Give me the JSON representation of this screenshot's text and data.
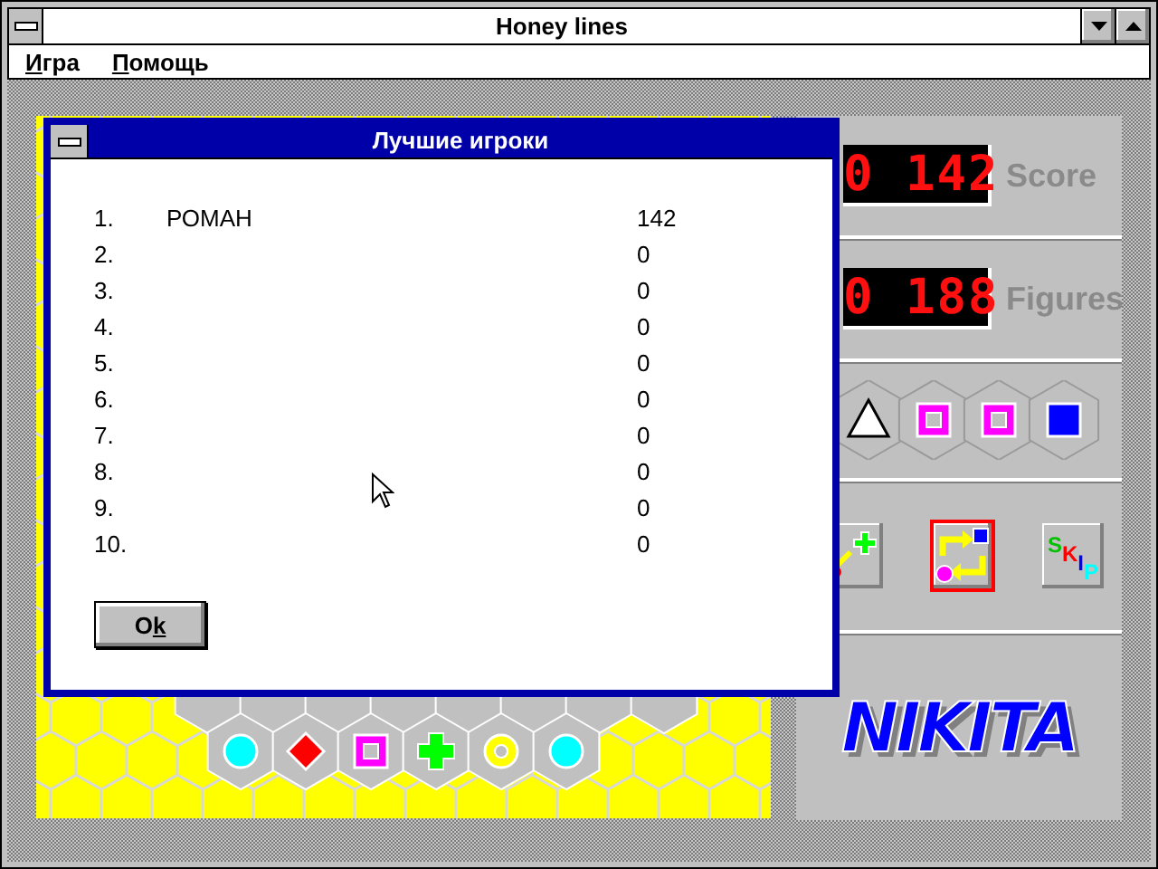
{
  "window": {
    "title": "Honey lines"
  },
  "menu": [
    {
      "label": "Игра"
    },
    {
      "label": "Помощь"
    }
  ],
  "board": {
    "bottom_row": [
      {
        "kind": "circle",
        "color": "#00ffff"
      },
      {
        "kind": "diamond",
        "color": "#ff0000"
      },
      {
        "kind": "square",
        "color": "#ff00ff"
      },
      {
        "kind": "cross",
        "color": "#00ff00"
      },
      {
        "kind": "ring",
        "color": "#ffff00"
      },
      {
        "kind": "circle",
        "color": "#00ffff"
      }
    ]
  },
  "panel": {
    "score": {
      "display": "0 142",
      "label": "Score"
    },
    "figures": {
      "display": "0 188",
      "label": "Figures"
    },
    "next": [
      {
        "kind": "triangle",
        "color": "#ffffff"
      },
      {
        "kind": "square",
        "color": "#ff00ff"
      },
      {
        "kind": "square",
        "color": "#ff00ff"
      },
      {
        "kind": "solid",
        "color": "#0000ff"
      }
    ],
    "tools": [
      {
        "kind": "lines",
        "selected": false
      },
      {
        "kind": "swap",
        "selected": true
      },
      {
        "kind": "skip",
        "selected": false,
        "letters": [
          {
            "text": "S",
            "color": "#00c000"
          },
          {
            "text": "K",
            "color": "#ff0000"
          },
          {
            "text": "I",
            "color": "#0000ff"
          },
          {
            "text": "P",
            "color": "#00ffff"
          }
        ]
      }
    ],
    "logo": "NIKITA"
  },
  "dialog": {
    "title": "Лучшие игроки",
    "rows": [
      {
        "rank": "1.",
        "name": "РОМАН",
        "score": "142"
      },
      {
        "rank": "2.",
        "name": "",
        "score": "0"
      },
      {
        "rank": "3.",
        "name": "",
        "score": "0"
      },
      {
        "rank": "4.",
        "name": "",
        "score": "0"
      },
      {
        "rank": "5.",
        "name": "",
        "score": "0"
      },
      {
        "rank": "6.",
        "name": "",
        "score": "0"
      },
      {
        "rank": "7.",
        "name": "",
        "score": "0"
      },
      {
        "rank": "8.",
        "name": "",
        "score": "0"
      },
      {
        "rank": "9.",
        "name": "",
        "score": "0"
      },
      {
        "rank": "10.",
        "name": "",
        "score": "0"
      }
    ],
    "button": {
      "label": "Ok"
    }
  }
}
